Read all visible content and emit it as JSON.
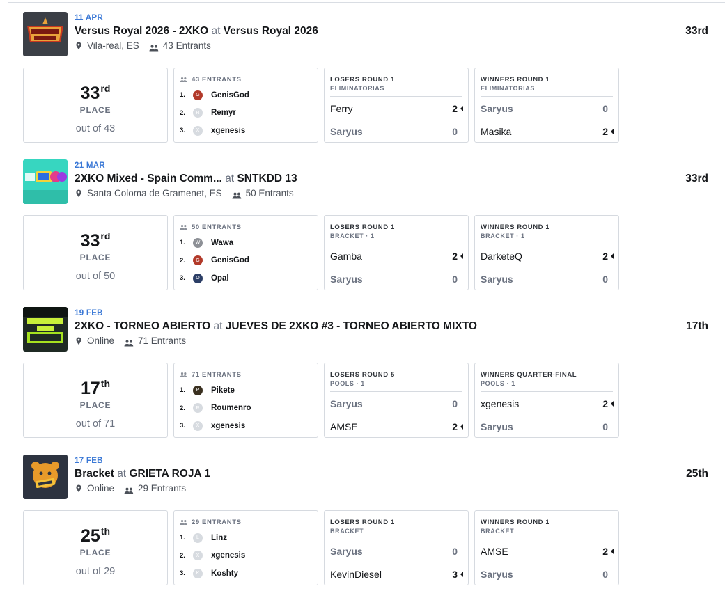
{
  "colors": {
    "accent": "#3a78d6",
    "text": "#15171a",
    "muted": "#6b7280",
    "border": "#d6dae0"
  },
  "icons": {
    "location": "map-pin-icon",
    "entrants": "people-icon"
  },
  "tournaments": [
    {
      "thumb": "versus-royal-logo",
      "date": "11 APR",
      "event": "Versus Royal 2026 - 2XKO",
      "at": "at",
      "tournament": "Versus Royal 2026",
      "location": "Vila-real, ES",
      "entrants_text": "43 Entrants",
      "placement": "33rd",
      "place_num": "33",
      "place_suffix": "rd",
      "place_label": "PLACE",
      "out_of": "out of 43",
      "entrants_header": "43 ENTRANTS",
      "top3": [
        {
          "rank": "1.",
          "name": "GenisGod",
          "avatar": "G",
          "avatar_color": "#b23a2a"
        },
        {
          "rank": "2.",
          "name": "Remyr",
          "avatar": "R",
          "avatar_color": "#d7dbe0"
        },
        {
          "rank": "3.",
          "name": "xgenesis",
          "avatar": "X",
          "avatar_color": "#d7dbe0"
        }
      ],
      "matches": [
        {
          "round": "LOSERS ROUND 1",
          "phase": "ELIMINATORIAS",
          "players": [
            {
              "name": "Ferry",
              "score": "2",
              "win": true
            },
            {
              "name": "Saryus",
              "score": "0",
              "win": false
            }
          ]
        },
        {
          "round": "WINNERS ROUND 1",
          "phase": "ELIMINATORIAS",
          "players": [
            {
              "name": "Saryus",
              "score": "0",
              "win": false
            },
            {
              "name": "Masika",
              "score": "2",
              "win": true
            }
          ]
        }
      ]
    },
    {
      "thumb": "sntkdd-logo",
      "date": "21 MAR",
      "event": "2XKO Mixed - Spain Comm...",
      "at": "at",
      "tournament": "SNTKDD 13",
      "location": "Santa Coloma de Gramenet, ES",
      "entrants_text": "50 Entrants",
      "placement": "33rd",
      "place_num": "33",
      "place_suffix": "rd",
      "place_label": "PLACE",
      "out_of": "out of 50",
      "entrants_header": "50 ENTRANTS",
      "top3": [
        {
          "rank": "1.",
          "name": "Wawa",
          "avatar": "W",
          "avatar_color": "#8d9096"
        },
        {
          "rank": "2.",
          "name": "GenisGod",
          "avatar": "G",
          "avatar_color": "#b23a2a"
        },
        {
          "rank": "3.",
          "name": "Opal",
          "avatar": "O",
          "avatar_color": "#2c3e66"
        }
      ],
      "matches": [
        {
          "round": "LOSERS ROUND 1",
          "phase": "BRACKET · 1",
          "players": [
            {
              "name": "Gamba",
              "score": "2",
              "win": true
            },
            {
              "name": "Saryus",
              "score": "0",
              "win": false
            }
          ]
        },
        {
          "round": "WINNERS ROUND 1",
          "phase": "BRACKET · 1",
          "players": [
            {
              "name": "DarketeQ",
              "score": "2",
              "win": true
            },
            {
              "name": "Saryus",
              "score": "0",
              "win": false
            }
          ]
        }
      ]
    },
    {
      "thumb": "jueves-de-2xko-logo",
      "date": "19 FEB",
      "event": "2XKO - TORNEO ABIERTO",
      "at": "at",
      "tournament": "JUEVES DE 2XKO #3 - TORNEO ABIERTO MIXTO",
      "location": "Online",
      "entrants_text": "71 Entrants",
      "placement": "17th",
      "place_num": "17",
      "place_suffix": "th",
      "place_label": "PLACE",
      "out_of": "out of 71",
      "entrants_header": "71 ENTRANTS",
      "top3": [
        {
          "rank": "1.",
          "name": "Pikete",
          "avatar": "P",
          "avatar_color": "#3a3020"
        },
        {
          "rank": "2.",
          "name": "Roumenro",
          "avatar": "R",
          "avatar_color": "#d7dbe0"
        },
        {
          "rank": "3.",
          "name": "xgenesis",
          "avatar": "X",
          "avatar_color": "#d7dbe0"
        }
      ],
      "matches": [
        {
          "round": "LOSERS ROUND 5",
          "phase": "POOLS · 1",
          "players": [
            {
              "name": "Saryus",
              "score": "0",
              "win": false
            },
            {
              "name": "AMSE",
              "score": "2",
              "win": true
            }
          ]
        },
        {
          "round": "WINNERS QUARTER-FINAL",
          "phase": "POOLS · 1",
          "players": [
            {
              "name": "xgenesis",
              "score": "2",
              "win": true
            },
            {
              "name": "Saryus",
              "score": "0",
              "win": false
            }
          ]
        }
      ]
    },
    {
      "thumb": "kings-logo",
      "date": "17 FEB",
      "event": "Bracket",
      "at": "at",
      "tournament": "GRIETA ROJA 1",
      "location": "Online",
      "entrants_text": "29 Entrants",
      "placement": "25th",
      "place_num": "25",
      "place_suffix": "th",
      "place_label": "PLACE",
      "out_of": "out of 29",
      "entrants_header": "29 ENTRANTS",
      "top3": [
        {
          "rank": "1.",
          "name": "Linz",
          "avatar": "L",
          "avatar_color": "#d7dbe0"
        },
        {
          "rank": "2.",
          "name": "xgenesis",
          "avatar": "X",
          "avatar_color": "#d7dbe0"
        },
        {
          "rank": "3.",
          "name": "Koshty",
          "avatar": "K",
          "avatar_color": "#d7dbe0"
        }
      ],
      "matches": [
        {
          "round": "LOSERS ROUND 1",
          "phase": "BRACKET",
          "players": [
            {
              "name": "Saryus",
              "score": "0",
              "win": false
            },
            {
              "name": "KevinDiesel",
              "score": "3",
              "win": true
            }
          ]
        },
        {
          "round": "WINNERS ROUND 1",
          "phase": "BRACKET",
          "players": [
            {
              "name": "AMSE",
              "score": "2",
              "win": true
            },
            {
              "name": "Saryus",
              "score": "0",
              "win": false
            }
          ]
        }
      ]
    }
  ]
}
